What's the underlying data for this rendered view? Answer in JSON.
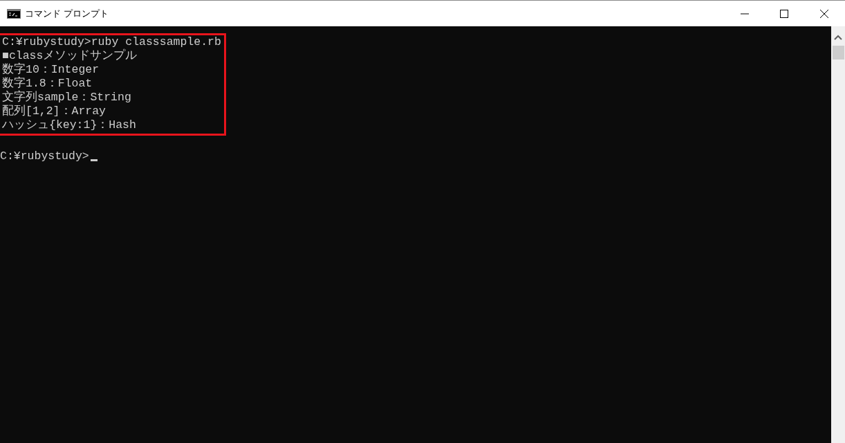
{
  "window": {
    "title": "コマンド プロンプト"
  },
  "console": {
    "highlighted_lines": [
      "C:¥rubystudy>ruby classsample.rb",
      "■classメソッドサンプル",
      "数字10：Integer",
      "数字1.8：Float",
      "文字列sample：String",
      "配列[1,2]：Array",
      "ハッシュ{key:1}：Hash"
    ],
    "lines_after": [
      "C:¥rubystudy>"
    ],
    "cursor": true
  }
}
